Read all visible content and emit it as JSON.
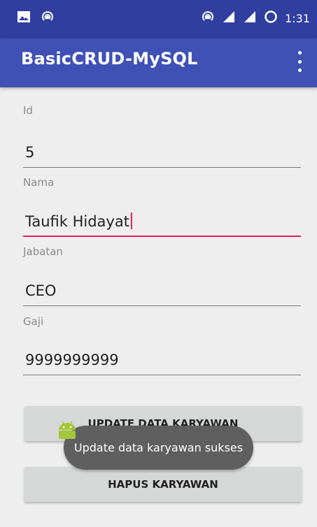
{
  "status_bar": {
    "left_icons": [
      "image-icon",
      "hotspot-icon"
    ],
    "right_icons": [
      "hotspot-icon",
      "signal-icon",
      "signal-icon",
      "circle-icon"
    ],
    "time": "1:31"
  },
  "app_bar": {
    "title": "BasicCRUD-MySQL",
    "menu_icon": "more-vert-icon"
  },
  "form": {
    "id": {
      "label": "Id",
      "value": "5"
    },
    "nama": {
      "label": "Nama",
      "value": "Taufik Hidayat"
    },
    "jabatan": {
      "label": "Jabatan",
      "value": "CEO"
    },
    "gaji": {
      "label": "Gaji",
      "value": "9999999999"
    }
  },
  "buttons": {
    "update": "UPDATE DATA KARYAWAN",
    "delete": "HAPUS KARYAWAN"
  },
  "toast": {
    "message": "Update data karyawan sukses",
    "icon": "android-icon"
  },
  "colors": {
    "primary": "#3f51b5",
    "primary_dark": "#303f9f",
    "accent": "#e91e63"
  }
}
